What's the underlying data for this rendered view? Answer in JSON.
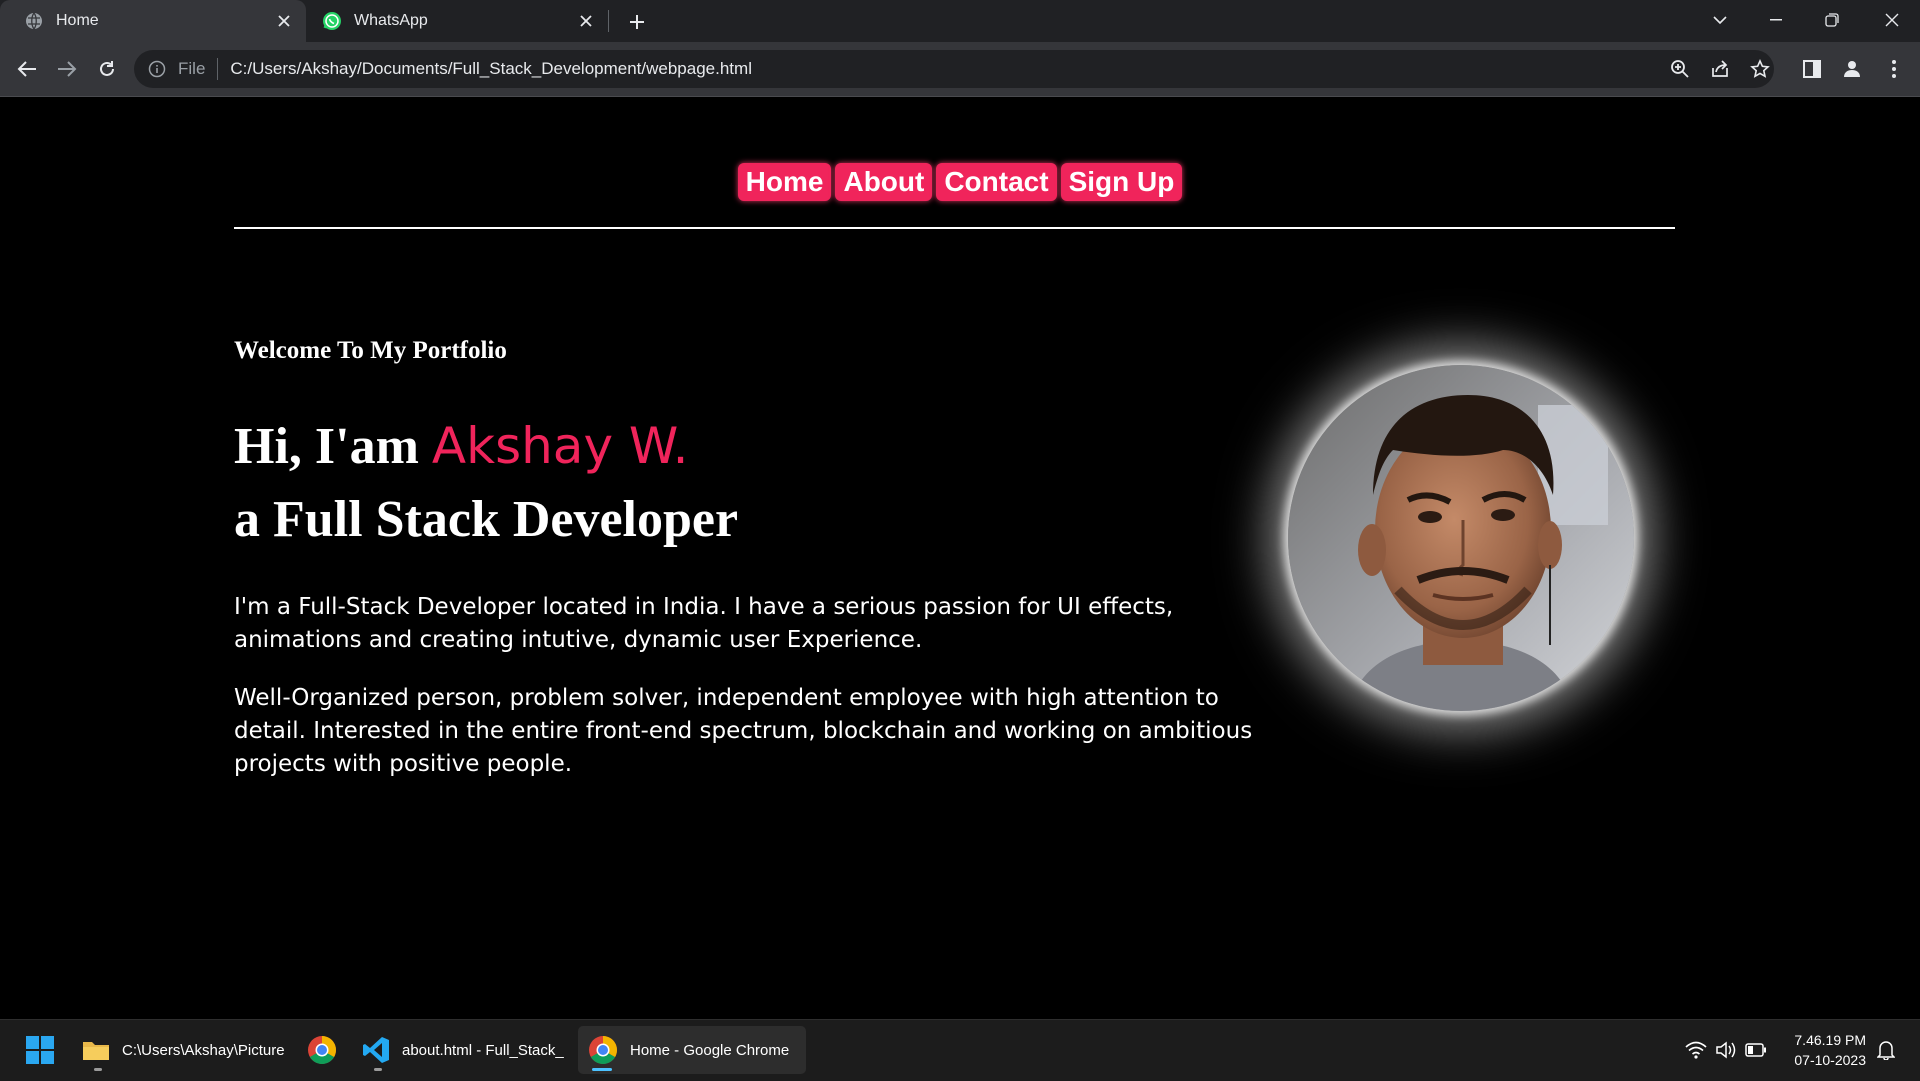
{
  "browser": {
    "tabs": [
      {
        "title": "Home",
        "icon": "globe-icon",
        "active": true
      },
      {
        "title": "WhatsApp",
        "icon": "whatsapp-icon",
        "active": false
      }
    ],
    "address": {
      "scheme_label": "File",
      "url": "C:/Users/Akshay/Documents/Full_Stack_Development/webpage.html"
    }
  },
  "page": {
    "nav": [
      "Home",
      "About",
      "Contact",
      "Sign Up"
    ],
    "welcome": "Welcome To My Portfolio",
    "greeting": "Hi, I'am",
    "name": "Akshay W.",
    "role": "a Full Stack Developer",
    "para1": "I'm a Full-Stack Developer located in India. I have a serious passion for UI effects, animations and creating intutive, dynamic user Experience.",
    "para2": "Well-Organized person, problem solver, independent employee with high attention to detail. Interested in the entire front-end spectrum, blockchain and working on ambitious projects with positive people.",
    "accent": "#f0245b"
  },
  "taskbar": {
    "items": [
      {
        "label": "C:\\Users\\Akshay\\Picture",
        "icon": "folder-icon"
      },
      {
        "label": "",
        "icon": "chrome-icon"
      },
      {
        "label": "about.html - Full_Stack_",
        "icon": "vscode-icon"
      },
      {
        "label": "Home - Google Chrome",
        "icon": "chrome-icon"
      }
    ],
    "time": "7.46.19 PM",
    "date": "07-10-2023"
  }
}
